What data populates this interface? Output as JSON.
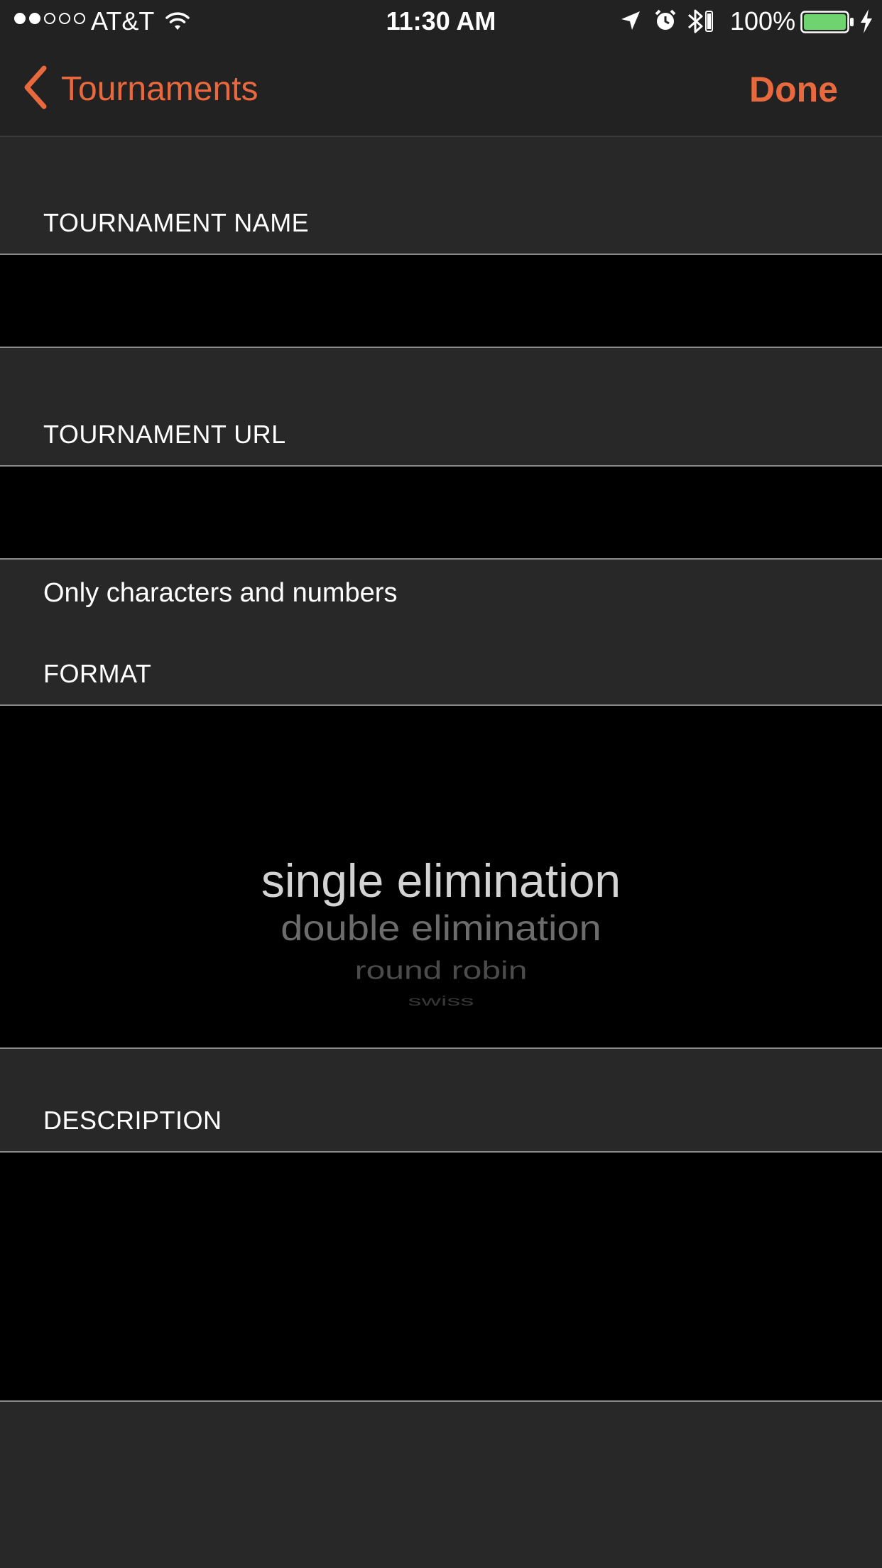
{
  "status_bar": {
    "carrier": "AT&T",
    "time": "11:30 AM",
    "battery_percent": "100%",
    "signal_bars_filled": 2,
    "signal_bars_total": 5,
    "battery_level": 1.0,
    "battery_color": "#6FD36F"
  },
  "nav": {
    "back_label": "Tournaments",
    "done_label": "Done",
    "accent_color": "#E8693D"
  },
  "form": {
    "name_label": "TOURNAMENT NAME",
    "name_value": "",
    "url_label": "TOURNAMENT URL",
    "url_value": "",
    "url_hint": "Only characters and numbers",
    "format_label": "FORMAT",
    "format_options": [
      "single elimination",
      "double elimination",
      "round robin",
      "swiss"
    ],
    "format_selected": "single elimination",
    "description_label": "DESCRIPTION",
    "description_value": ""
  }
}
